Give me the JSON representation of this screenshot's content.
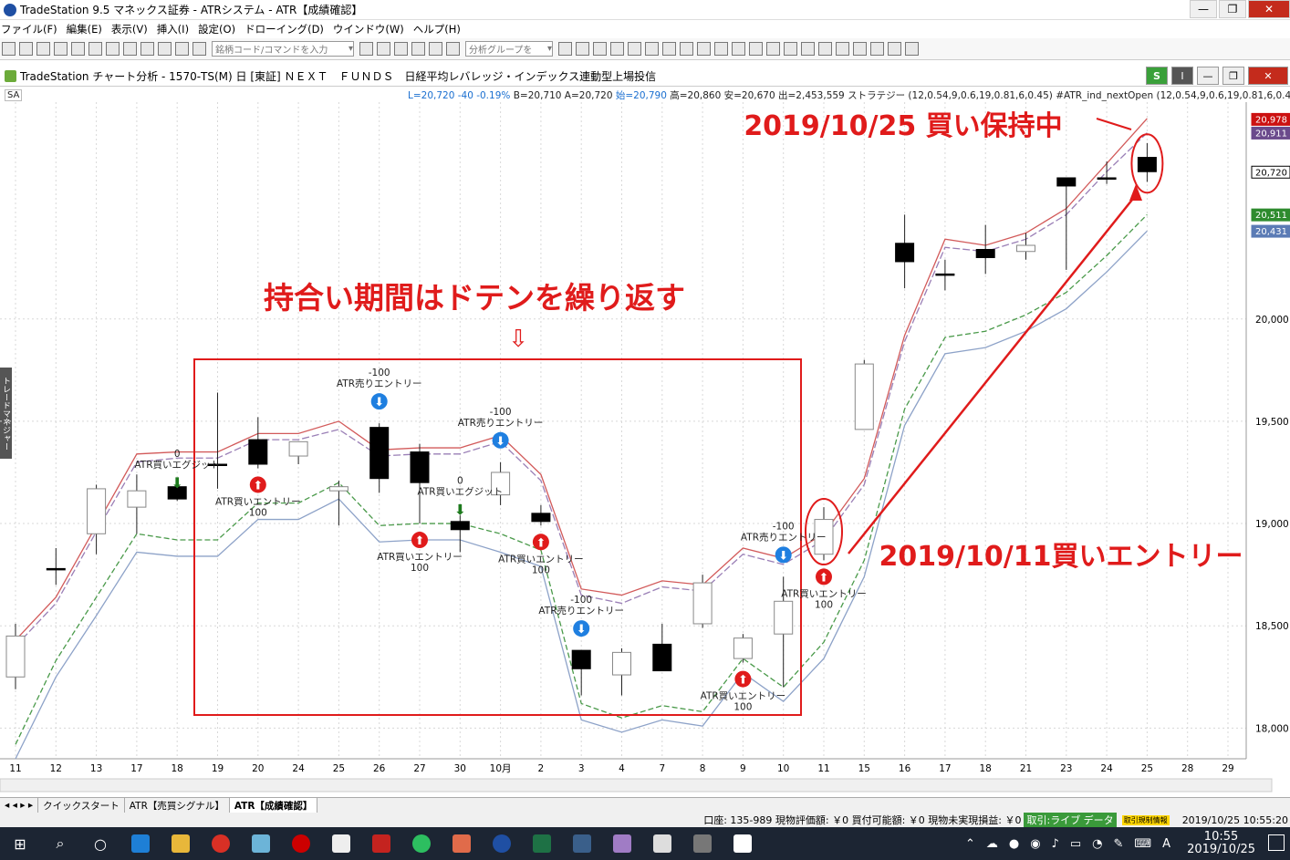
{
  "window": {
    "title": "TradeStation 9.5 マネックス証券 - ATRシステム - ATR【成績確認】",
    "min": "—",
    "max": "❐",
    "close": "✕"
  },
  "menu": [
    "ファイル(F)",
    "編集(E)",
    "表示(V)",
    "挿入(I)",
    "設定(O)",
    "ドローイング(D)",
    "ウインドウ(W)",
    "ヘルプ(H)"
  ],
  "toolbar": {
    "symbol_placeholder": "銘柄コード/コマンドを入力",
    "group_placeholder": "分析グループを"
  },
  "chart_window": {
    "title": "TradeStation チャート分析 - 1570-TS(M) 日 [東証] ＮＥＸＴ　ＦＵＮＤＳ　日経平均レバレッジ・インデックス連動型上場投信",
    "s_btn": "S",
    "i_btn": "I"
  },
  "infobar": {
    "sa": "SA",
    "quote_blue": "L=20,720  -40  -0.19%",
    "quote_b": "B=20,710  A=20,720",
    "quote_open": "始=20,790",
    "quote_rest": "高=20,860  安=20,670  出=2,453,559  ストラテジー  (12,0.54,9,0.6,19,0.81,6,0.45)   #ATR_ind_nextOpen (12,0.54,9,0.6,19,0.81,6,0.45)"
  },
  "side_tab": "トレードマネジャー",
  "chart_data": {
    "type": "candlestick",
    "x_labels": [
      "11",
      "12",
      "13",
      "17",
      "18",
      "19",
      "20",
      "24",
      "25",
      "26",
      "27",
      "30",
      "10月",
      "2",
      "3",
      "4",
      "7",
      "8",
      "9",
      "10",
      "11",
      "15",
      "16",
      "17",
      "18",
      "21",
      "23",
      "24",
      "25",
      "28",
      "29"
    ],
    "ylim": [
      17850,
      21060
    ],
    "yticks": [
      18000,
      18500,
      19000,
      19500,
      20000
    ],
    "ytick_labels": [
      "18,000",
      "18,500",
      "19,000",
      "19,500",
      "20,000"
    ],
    "price_tags": [
      {
        "label": "20,978",
        "value": 20978,
        "color": "#cc1111"
      },
      {
        "label": "20,911",
        "value": 20911,
        "color": "#6b4a8c"
      },
      {
        "label": "20,720",
        "value": 20720,
        "color": "#000000"
      },
      {
        "label": "20,511",
        "value": 20511,
        "color": "#2e8b2e"
      },
      {
        "label": "20,431",
        "value": 20431,
        "color": "#5b7bb5"
      }
    ],
    "candles": [
      {
        "o": 18250,
        "h": 18510,
        "l": 18190,
        "c": 18450
      },
      {
        "o": 18780,
        "h": 18880,
        "l": 18700,
        "c": 18780
      },
      {
        "o": 18950,
        "h": 19190,
        "l": 18850,
        "c": 19170
      },
      {
        "o": 19080,
        "h": 19240,
        "l": 18950,
        "c": 19160
      },
      {
        "o": 19180,
        "h": 19220,
        "l": 19110,
        "c": 19120
      },
      {
        "o": 19290,
        "h": 19640,
        "l": 19170,
        "c": 19290
      },
      {
        "o": 19410,
        "h": 19520,
        "l": 19270,
        "c": 19290
      },
      {
        "o": 19330,
        "h": 19390,
        "l": 19290,
        "c": 19400
      },
      {
        "o": 19160,
        "h": 19210,
        "l": 18990,
        "c": 19180
      },
      {
        "o": 19470,
        "h": 19490,
        "l": 19150,
        "c": 19220
      },
      {
        "o": 19350,
        "h": 19390,
        "l": 19000,
        "c": 19200
      },
      {
        "o": 19010,
        "h": 19040,
        "l": 18860,
        "c": 18970
      },
      {
        "o": 19140,
        "h": 19300,
        "l": 19090,
        "c": 19250
      },
      {
        "o": 19050,
        "h": 19090,
        "l": 18990,
        "c": 19010
      },
      {
        "o": 18380,
        "h": 18380,
        "l": 18160,
        "c": 18290
      },
      {
        "o": 18260,
        "h": 18390,
        "l": 18160,
        "c": 18370
      },
      {
        "o": 18410,
        "h": 18510,
        "l": 18280,
        "c": 18280
      },
      {
        "o": 18510,
        "h": 18750,
        "l": 18490,
        "c": 18710
      },
      {
        "o": 18340,
        "h": 18460,
        "l": 18320,
        "c": 18440
      },
      {
        "o": 18460,
        "h": 18740,
        "l": 18200,
        "c": 18620
      },
      {
        "o": 18850,
        "h": 19080,
        "l": 18820,
        "c": 19020
      },
      {
        "o": 19460,
        "h": 19800,
        "l": 19470,
        "c": 19780
      },
      {
        "o": 20370,
        "h": 20510,
        "l": 20150,
        "c": 20280
      },
      {
        "o": 20220,
        "h": 20290,
        "l": 20140,
        "c": 20220
      },
      {
        "o": 20340,
        "h": 20460,
        "l": 20220,
        "c": 20300
      },
      {
        "o": 20330,
        "h": 20420,
        "l": 20290,
        "c": 20360
      },
      {
        "o": 20690,
        "h": 20690,
        "l": 20240,
        "c": 20650
      },
      {
        "o": 20690,
        "h": 20770,
        "l": 20660,
        "c": 20690
      },
      {
        "o": 20790,
        "h": 20860,
        "l": 20670,
        "c": 20720
      }
    ],
    "lines": [
      {
        "name": "upper-red",
        "color": "#d25a5a",
        "values": [
          18430,
          18640,
          18990,
          19340,
          19350,
          19350,
          19440,
          19440,
          19500,
          19360,
          19370,
          19370,
          19430,
          19240,
          18680,
          18650,
          18720,
          18700,
          18880,
          18830,
          18950,
          19220,
          19920,
          20390,
          20360,
          20420,
          20540,
          20760,
          20980,
          null,
          null
        ]
      },
      {
        "name": "upper-purple",
        "color": "#9a7fb6",
        "values": [
          18400,
          18610,
          18960,
          19300,
          19320,
          19320,
          19410,
          19410,
          19460,
          19330,
          19340,
          19340,
          19400,
          19210,
          18650,
          18610,
          18690,
          18670,
          18850,
          18800,
          18920,
          19190,
          19890,
          20350,
          20330,
          20390,
          20510,
          20720,
          20910,
          null,
          null
        ]
      },
      {
        "name": "lower-green",
        "color": "#4a9a4a",
        "values": [
          17920,
          18330,
          18640,
          18950,
          18920,
          18920,
          19100,
          19100,
          19200,
          18990,
          19000,
          19000,
          18950,
          18870,
          18120,
          18050,
          18110,
          18080,
          18340,
          18200,
          18420,
          18820,
          19560,
          19910,
          19940,
          20020,
          20130,
          20310,
          20510,
          null,
          null
        ]
      },
      {
        "name": "lower-blue",
        "color": "#8da2c8",
        "values": [
          17850,
          18250,
          18550,
          18860,
          18840,
          18840,
          19020,
          19020,
          19120,
          18910,
          18920,
          18920,
          18860,
          18790,
          18040,
          17980,
          18040,
          18010,
          18270,
          18130,
          18340,
          18740,
          19480,
          19830,
          19860,
          19940,
          20050,
          20230,
          20430,
          null,
          null
        ]
      }
    ],
    "annotations": {
      "big_title": "持合い期間はドテンを繰り返す",
      "arrow_down": "⇩",
      "hold_label": "2019/10/25  買い保持中",
      "entry_label": "2019/10/11買いエントリー"
    },
    "signals": [
      {
        "i": 4,
        "dir": "exit",
        "label": "ATR買いエグジット",
        "qty": "0",
        "price": 19120
      },
      {
        "i": 6,
        "dir": "buy",
        "label": "ATR買いエントリー",
        "qty": "100",
        "price": 19270
      },
      {
        "i": 9,
        "dir": "sell",
        "label": "ATR売りエントリー",
        "qty": "-100",
        "price": 19490
      },
      {
        "i": 10,
        "dir": "buy",
        "label": "ATR買いエントリー",
        "qty": "100",
        "price": 19000
      },
      {
        "i": 11,
        "dir": "exit",
        "label": "ATR買いエグジット",
        "qty": "0",
        "price": 18990
      },
      {
        "i": 12,
        "dir": "sell",
        "label": "ATR売りエントリー",
        "qty": "-100",
        "price": 19300
      },
      {
        "i": 13,
        "dir": "buy",
        "label": "ATR買いエントリー",
        "qty": "100",
        "price": 18990
      },
      {
        "i": 14,
        "dir": "sell",
        "label": "ATR売りエントリー",
        "qty": "-100",
        "price": 18380
      },
      {
        "i": 18,
        "dir": "buy",
        "label": "ATR買いエントリー",
        "qty": "100",
        "price": 18320
      },
      {
        "i": 19,
        "dir": "sell",
        "label": "ATR売りエントリー",
        "qty": "-100",
        "price": 18740
      },
      {
        "i": 20,
        "dir": "buy",
        "label": "ATR買いエントリー",
        "qty": "100",
        "price": 18820
      }
    ]
  },
  "tabs": [
    "クイックスタート",
    "ATR【売買シグナル】",
    "ATR【成績確認】"
  ],
  "account": {
    "text": "口座:  135-989  現物評価額:  ￥0  買付可能額:  ￥0  現物未実現損益:  ￥0",
    "live": "取引:ライブ  データ",
    "warn": "取引規制情報",
    "datetime": "2019/10/25 10:55:20"
  },
  "taskbar": {
    "clock_time": "10:55",
    "clock_date": "2019/10/25",
    "ime": "A"
  }
}
